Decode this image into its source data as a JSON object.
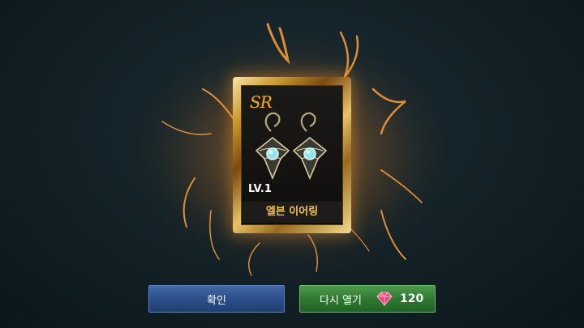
{
  "card": {
    "rarity": "SR",
    "level": "LV.1",
    "item_name": "엘븐 이어링"
  },
  "buttons": {
    "confirm_label": "확인",
    "reopen_label": "다시 열기",
    "reopen_cost": "120"
  },
  "icons": {
    "item": "elven-earrings-icon",
    "currency": "ruby-gem-icon"
  },
  "colors": {
    "rarity": "#e8a93a",
    "item_name": "#f0c348",
    "confirm_button": "#2c4f8a",
    "reopen_button": "#2f7a32"
  }
}
